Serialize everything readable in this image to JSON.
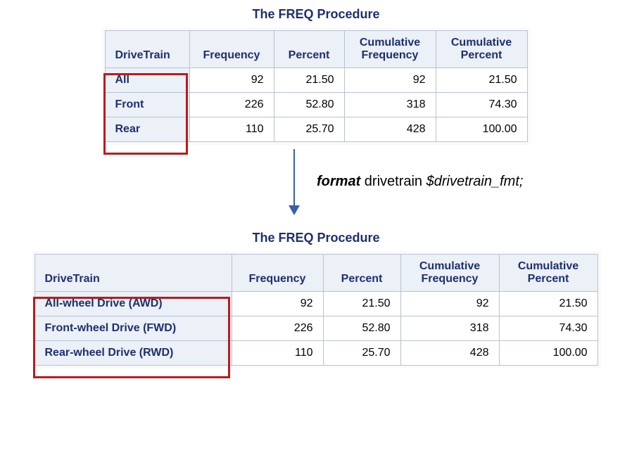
{
  "title": "The FREQ Procedure",
  "headers": {
    "varname": "DriveTrain",
    "frequency": "Frequency",
    "percent": "Percent",
    "cumfreq_line1": "Cumulative",
    "cumfreq_line2": "Frequency",
    "cumpct_line1": "Cumulative",
    "cumpct_line2": "Percent"
  },
  "table1": {
    "rows": [
      {
        "cat": "All",
        "freq": "92",
        "pct": "21.50",
        "cfreq": "92",
        "cpct": "21.50"
      },
      {
        "cat": "Front",
        "freq": "226",
        "pct": "52.80",
        "cfreq": "318",
        "cpct": "74.30"
      },
      {
        "cat": "Rear",
        "freq": "110",
        "pct": "25.70",
        "cfreq": "428",
        "cpct": "100.00"
      }
    ]
  },
  "format_stmt": {
    "keyword": "format",
    "var": " drivetrain ",
    "fmt": "$drivetrain_fmt;"
  },
  "table2": {
    "rows": [
      {
        "cat": "All-wheel Drive (AWD)",
        "freq": "92",
        "pct": "21.50",
        "cfreq": "92",
        "cpct": "21.50"
      },
      {
        "cat": "Front-wheel Drive (FWD)",
        "freq": "226",
        "pct": "52.80",
        "cfreq": "318",
        "cpct": "74.30"
      },
      {
        "cat": "Rear-wheel Drive (RWD)",
        "freq": "110",
        "pct": "25.70",
        "cfreq": "428",
        "cpct": "100.00"
      }
    ]
  }
}
